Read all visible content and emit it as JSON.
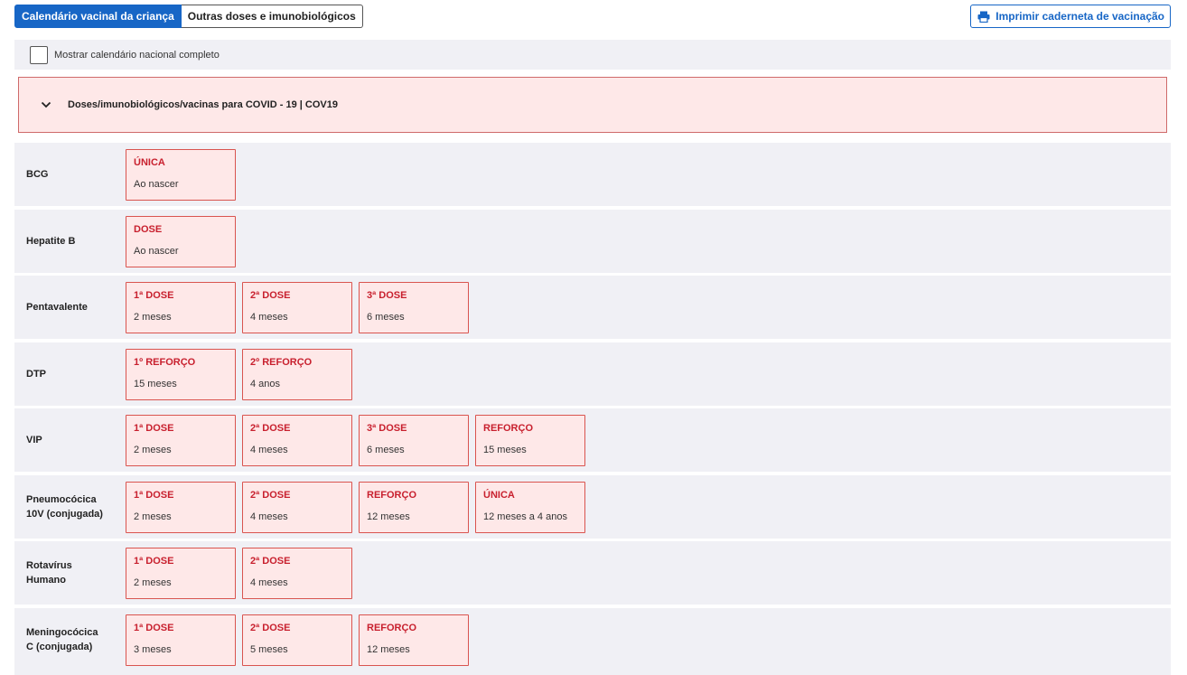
{
  "tabs": {
    "active_label": "Calendário vacinal da criança",
    "other_label": "Outras doses e imunobiológicos"
  },
  "print_button": {
    "label": "Imprimir caderneta de vacinação",
    "icon": "printer-icon"
  },
  "toggle": {
    "label": "Mostrar calendário nacional completo",
    "checked": false
  },
  "covid_section": {
    "label": "Doses/imunobiológicos/vacinas para COVID - 19 | COV19",
    "icon": "chevron-down-icon"
  },
  "colors": {
    "accent": "#1766c6",
    "dose_bg": "#fee8e8",
    "dose_border": "#d9544f",
    "dose_label": "#c8202e",
    "row_bg": "#f0f0f5"
  },
  "vaccines": [
    {
      "name_lines": [
        "BCG"
      ],
      "doses": [
        {
          "type": "ÚNICA",
          "age": "Ao nascer"
        }
      ]
    },
    {
      "name_lines": [
        "Hepatite B"
      ],
      "doses": [
        {
          "type": "DOSE",
          "age": "Ao nascer"
        }
      ]
    },
    {
      "name_lines": [
        "Pentavalente"
      ],
      "doses": [
        {
          "type": "1ª DOSE",
          "age": "2 meses"
        },
        {
          "type": "2ª DOSE",
          "age": "4 meses"
        },
        {
          "type": "3ª DOSE",
          "age": "6 meses"
        }
      ]
    },
    {
      "name_lines": [
        "DTP"
      ],
      "doses": [
        {
          "type": "1º REFORÇO",
          "age": "15 meses"
        },
        {
          "type": "2º REFORÇO",
          "age": "4 anos"
        }
      ]
    },
    {
      "name_lines": [
        "VIP"
      ],
      "doses": [
        {
          "type": "1ª DOSE",
          "age": "2 meses"
        },
        {
          "type": "2ª DOSE",
          "age": "4 meses"
        },
        {
          "type": "3ª DOSE",
          "age": "6 meses"
        },
        {
          "type": "REFORÇO",
          "age": "15 meses"
        }
      ]
    },
    {
      "name_lines": [
        "Pneumocócica",
        "10V (conjugada)"
      ],
      "doses": [
        {
          "type": "1ª DOSE",
          "age": "2 meses"
        },
        {
          "type": "2ª DOSE",
          "age": "4 meses"
        },
        {
          "type": "REFORÇO",
          "age": "12 meses"
        },
        {
          "type": "ÚNICA",
          "age": "12 meses a 4 anos"
        }
      ]
    },
    {
      "name_lines": [
        "Rotavírus",
        "Humano"
      ],
      "doses": [
        {
          "type": "1ª DOSE",
          "age": "2 meses"
        },
        {
          "type": "2ª DOSE",
          "age": "4 meses"
        }
      ]
    },
    {
      "name_lines": [
        "Meningocócica",
        "C (conjugada)"
      ],
      "doses": [
        {
          "type": "1ª DOSE",
          "age": "3 meses"
        },
        {
          "type": "2ª DOSE",
          "age": "5 meses"
        },
        {
          "type": "REFORÇO",
          "age": "12 meses"
        }
      ]
    }
  ]
}
